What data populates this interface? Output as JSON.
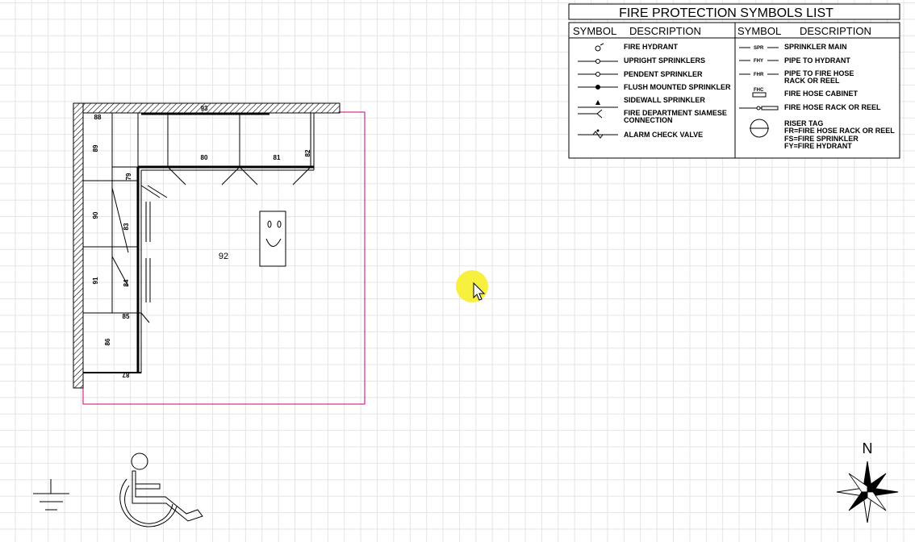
{
  "legend": {
    "title": "FIRE PROTECTION SYMBOLS LIST",
    "col_symbol": "SYMBOL",
    "col_description": "DESCRIPTION",
    "left_items": [
      "FIRE HYDRANT",
      "UPRIGHT SPRINKLERS",
      "PENDENT SPRINKLER",
      "FLUSH MOUNTED SPRINKLER",
      "SIDEWALL SPRINKLER",
      "FIRE DEPARTMENT SIAMESE",
      "CONNECTION",
      "ALARM CHECK VALVE"
    ],
    "right_items": [
      "SPRINKLER MAIN",
      "PIPE TO HYDRANT",
      "PIPE TO FIRE HOSE",
      "RACK OR REEL",
      "FIRE HOSE CABINET",
      "FIRE HOSE RACK OR REEL",
      "RISER TAG",
      "FR=FIRE HOSE RACK OR REEL",
      "FS=FIRE SPRINKLER",
      "FY=FIRE HYDRANT"
    ],
    "right_symbols": [
      "SPR",
      "FHY",
      "FHR",
      "FHC"
    ]
  },
  "plan": {
    "room_label": "92",
    "cabinet_labels": {
      "c93": "93",
      "c88": "88",
      "c89": "89",
      "c90": "90",
      "c91": "91",
      "c80": "80",
      "c81": "81",
      "c82": "82",
      "c79": "79",
      "c83": "83",
      "c84": "84",
      "c85": "85",
      "c86": "86",
      "c87": "87"
    }
  },
  "compass": {
    "north": "N"
  },
  "colors": {
    "boundary": "#cc0077",
    "cursor_highlight": "#f7ee2a"
  }
}
